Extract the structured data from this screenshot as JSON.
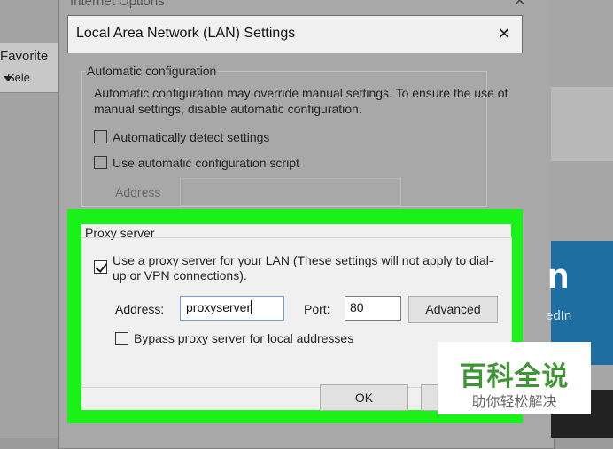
{
  "background": {
    "favorites_label": "Favorite",
    "select_label": "Sele",
    "internet_options_title": "Internet Options",
    "minimize_glyph": "−",
    "close_glyph": "✕",
    "right_panel_letter": "n",
    "right_panel_text": "edIn"
  },
  "dialog": {
    "title": "Local Area Network (LAN) Settings",
    "close_glyph": "✕",
    "automatic": {
      "group_label": "Automatic configuration",
      "description": "Automatic configuration may override manual settings.  To ensure the use of manual settings, disable automatic configuration.",
      "detect_label": "Automatically detect settings",
      "detect_checked": false,
      "script_label": "Use automatic configuration script",
      "script_checked": false,
      "address_label": "Address",
      "address_value": ""
    },
    "proxy": {
      "group_label": "Proxy server",
      "use_proxy_label": "Use a proxy server for your LAN (These settings will not apply to dial-up or VPN connections).",
      "use_proxy_checked": true,
      "address_label": "Address:",
      "address_value": "proxyserver",
      "port_label": "Port:",
      "port_value": "80",
      "advanced_label": "Advanced",
      "bypass_label": "Bypass proxy server for local addresses",
      "bypass_checked": false
    },
    "ok_label": "OK",
    "cancel_label": ""
  },
  "highlight_color": "#19f119",
  "watermark": {
    "line1": "百科全说",
    "line2": "助你轻松解决"
  }
}
